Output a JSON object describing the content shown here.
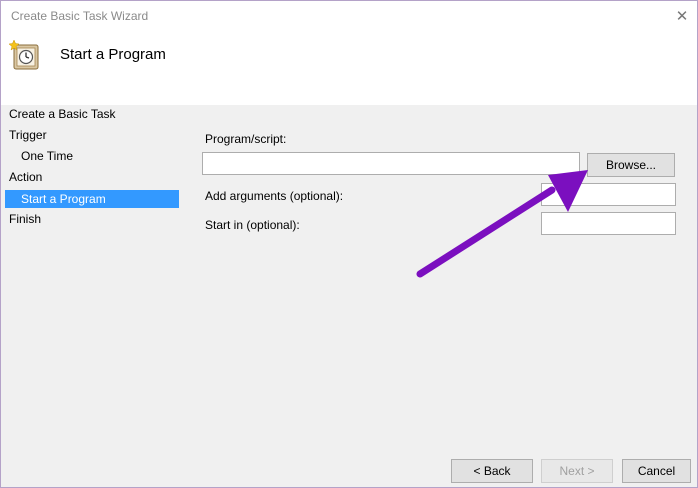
{
  "window": {
    "title": "Create Basic Task Wizard",
    "close_glyph": "✕"
  },
  "header": {
    "title": "Start a Program",
    "icon": "task-scheduler-icon"
  },
  "nav": {
    "items": [
      {
        "label": "Create a Basic Task",
        "level": 0,
        "selected": false
      },
      {
        "label": "Trigger",
        "level": 0,
        "selected": false
      },
      {
        "label": "One Time",
        "level": 1,
        "selected": false
      },
      {
        "label": "Action",
        "level": 0,
        "selected": false
      },
      {
        "label": "Start a Program",
        "level": 1,
        "selected": true
      },
      {
        "label": "Finish",
        "level": 0,
        "selected": false
      }
    ]
  },
  "form": {
    "program_label": "Program/script:",
    "program_value": "",
    "browse_label": "Browse...",
    "arguments_label": "Add arguments (optional):",
    "arguments_value": "",
    "start_in_label": "Start in (optional):",
    "start_in_value": ""
  },
  "footer": {
    "back_label": "< Back",
    "next_label": "Next >",
    "cancel_label": "Cancel"
  },
  "colors": {
    "selection": "#3399ff",
    "annotation_arrow": "#7b0fbf"
  }
}
